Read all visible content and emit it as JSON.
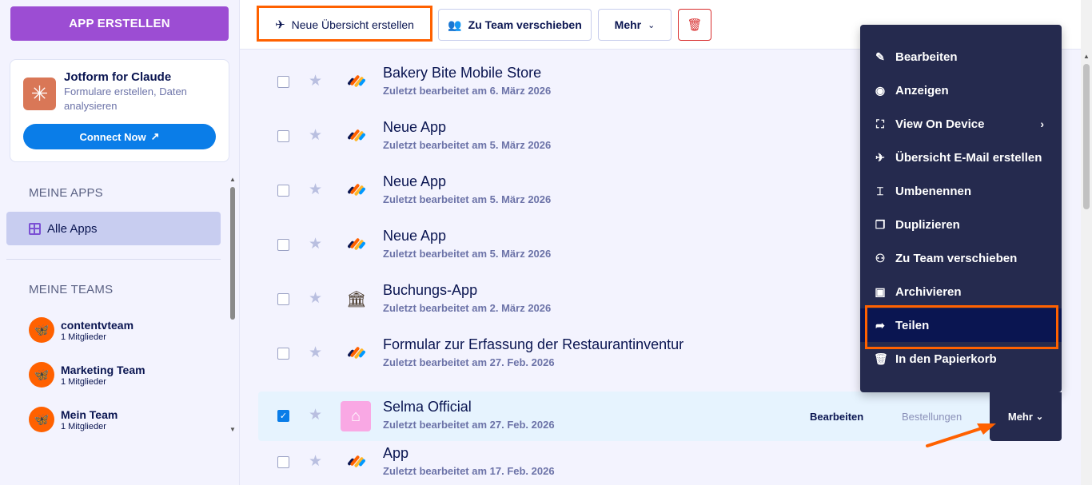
{
  "sidebar": {
    "create_button": "APP ERSTELLEN",
    "promo": {
      "title": "Jotform for Claude",
      "subtitle": "Formulare erstellen, Daten analysieren",
      "button": "Connect Now"
    },
    "my_apps_label": "MEINE APPS",
    "all_apps_label": "Alle Apps",
    "my_teams_label": "MEINE TEAMS",
    "teams": [
      {
        "name": "contentvteam",
        "members": "1 Mitglieder"
      },
      {
        "name": "Marketing Team",
        "members": "1 Mitglieder"
      },
      {
        "name": "Mein Team",
        "members": "1 Mitglieder"
      }
    ]
  },
  "toolbar": {
    "new_overview": "Neue Übersicht erstellen",
    "move_team": "Zu Team verschieben",
    "more": "Mehr"
  },
  "apps": [
    {
      "title": "Bakery Bite Mobile Store",
      "edited": "Zuletzt bearbeitet am 6. März 2026",
      "icon": "jotform-pencil-icon",
      "checked": false
    },
    {
      "title": "Neue App",
      "edited": "Zuletzt bearbeitet am 5. März 2026",
      "icon": "jotform-pencil-icon",
      "checked": false
    },
    {
      "title": "Neue App",
      "edited": "Zuletzt bearbeitet am 5. März 2026",
      "icon": "jotform-pencil-icon",
      "checked": false
    },
    {
      "title": "Neue App",
      "edited": "Zuletzt bearbeitet am 5. März 2026",
      "icon": "jotform-pencil-icon",
      "checked": false
    },
    {
      "title": "Buchungs-App",
      "edited": "Zuletzt bearbeitet am 2. März 2026",
      "icon": "bank-icon",
      "checked": false
    },
    {
      "title": "Formular zur Erfassung der Restaurantinventur",
      "edited": "Zuletzt bearbeitet am 27. Feb. 2026",
      "icon": "jotform-pencil-icon",
      "checked": false
    },
    {
      "title": "Selma Official",
      "edited": "Zuletzt bearbeitet am 27. Feb. 2026",
      "icon": "hanger-icon",
      "checked": true
    },
    {
      "title": "App",
      "edited": "Zuletzt bearbeitet am 17. Feb. 2026",
      "icon": "jotform-pencil-icon",
      "checked": false
    }
  ],
  "selected_row": {
    "edit": "Bearbeiten",
    "orders": "Bestellungen",
    "more": "Mehr"
  },
  "menu": {
    "items": [
      {
        "label": "Bearbeiten",
        "icon": "edit-icon"
      },
      {
        "label": "Anzeigen",
        "icon": "eye-icon"
      },
      {
        "label": "View On Device",
        "icon": "device-scan-icon"
      },
      {
        "label": "Übersicht E-Mail erstellen",
        "icon": "paper-plane-icon"
      },
      {
        "label": "Umbenennen",
        "icon": "rename-icon"
      },
      {
        "label": "Duplizieren",
        "icon": "duplicate-icon"
      },
      {
        "label": "Zu Team verschieben",
        "icon": "team-icon"
      },
      {
        "label": "Archivieren",
        "icon": "archive-icon"
      },
      {
        "label": "Teilen",
        "icon": "share-icon"
      },
      {
        "label": "In den Papierkorb",
        "icon": "trash-icon"
      }
    ]
  },
  "colors": {
    "accent": "#ff6100",
    "create_button": "#9c4dd3",
    "primary_blue": "#0a7de8",
    "menu_bg": "#252a4e",
    "navy": "#0a1551"
  }
}
